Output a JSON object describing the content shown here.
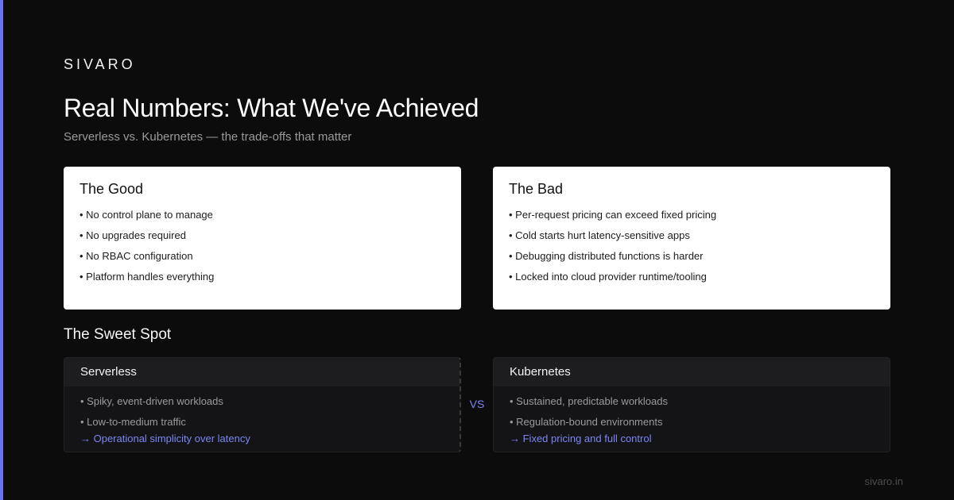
{
  "brand": "SIVARO",
  "title": "Real Numbers: What We've Achieved",
  "subtitle": "Serverless vs. Kubernetes — the trade-offs that matter",
  "good": {
    "heading": "The Good",
    "items": [
      "No control plane to manage",
      "No upgrades required",
      "No RBAC configuration",
      "Platform handles everything"
    ]
  },
  "bad": {
    "heading": "The Bad",
    "items": [
      "Per-request pricing can exceed fixed pricing",
      "Cold starts hurt latency-sensitive apps",
      "Debugging distributed functions is harder",
      "Locked into cloud provider runtime/tooling"
    ]
  },
  "sweet_spot": {
    "heading": "The Sweet Spot",
    "vs_label": "VS",
    "serverless": {
      "heading": "Serverless",
      "items": [
        "Spiky, event-driven workloads",
        "Low-to-medium traffic"
      ],
      "note": "→ Operational simplicity over latency"
    },
    "kubernetes": {
      "heading": "Kubernetes",
      "items": [
        "Sustained, predictable workloads",
        "Regulation-bound environments"
      ],
      "note": "→ Fixed pricing and full control"
    }
  },
  "footer": "sivaro.in",
  "colors": {
    "background": "#0c0c0c",
    "accent": "#6b74f0",
    "link": "#7d85f5",
    "card": "#ffffff"
  }
}
